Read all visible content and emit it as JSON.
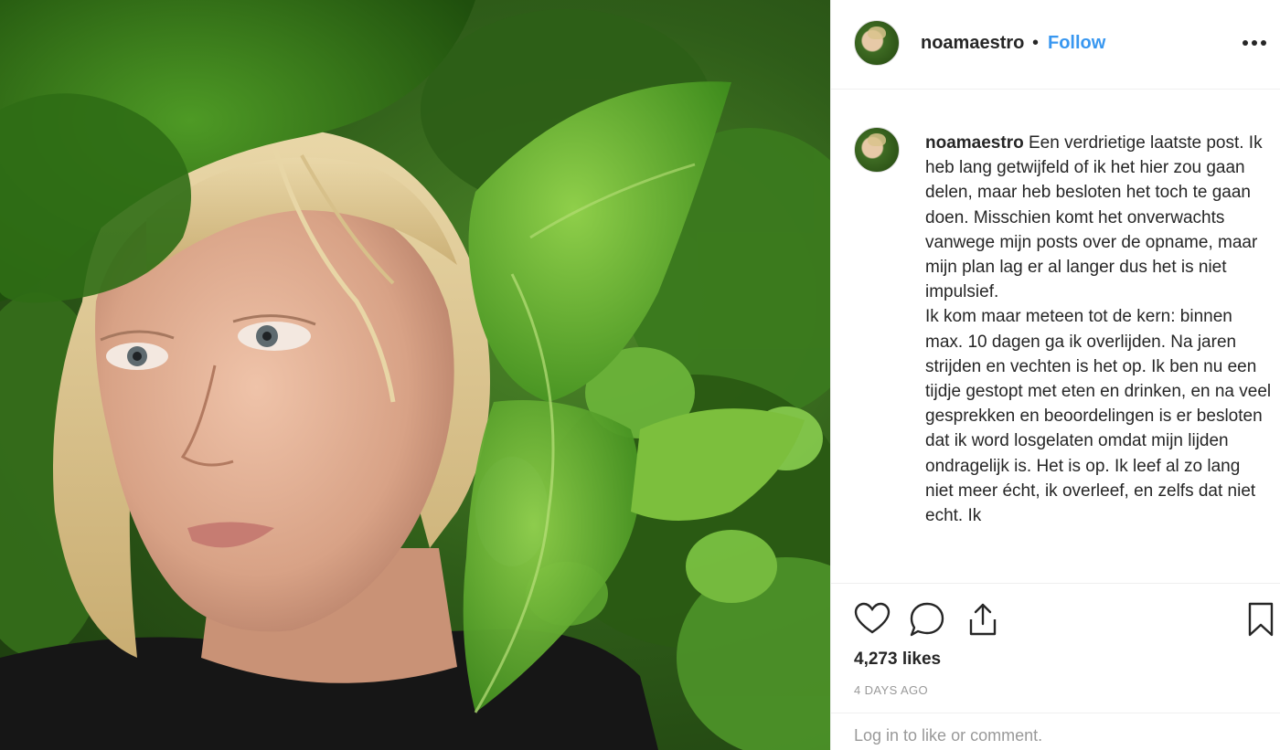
{
  "post": {
    "photo": {
      "description": "",
      "icon": "photo"
    },
    "header": {
      "username": "noamaestro",
      "separator": "•",
      "follow_label": "Follow",
      "more_icon": "ellipsis-icon"
    },
    "caption": {
      "username": "noamaestro",
      "text": "Een verdrietige laatste post. Ik heb lang getwijfeld of ik het hier zou gaan delen, maar heb besloten het toch te gaan doen. Misschien komt het onverwachts vanwege mijn posts over de opname, maar mijn plan lag er al langer dus het is niet impulsief.\nIk kom maar meteen tot de kern: binnen max. 10 dagen ga ik overlijden. Na jaren strijden en vechten is het op. Ik ben nu een tijdje gestopt met eten en drinken, en na veel gesprekken en beoordelingen is er besloten dat ik word losgelaten omdat mijn lijden ondragelijk is. Het is op. Ik leef al zo lang niet meer écht, ik overleef, en zelfs dat niet echt. Ik"
    },
    "actions": {
      "like_icon": "heart-icon",
      "comment_icon": "comment-icon",
      "share_icon": "share-icon",
      "save_icon": "bookmark-icon"
    },
    "likes": "4,273 likes",
    "timestamp": "4 DAYS AGO",
    "login_prompt": "Log in to like or comment."
  },
  "colors": {
    "accent": "#3897f0",
    "text": "#262626",
    "muted": "#999999",
    "border": "#efefef"
  }
}
